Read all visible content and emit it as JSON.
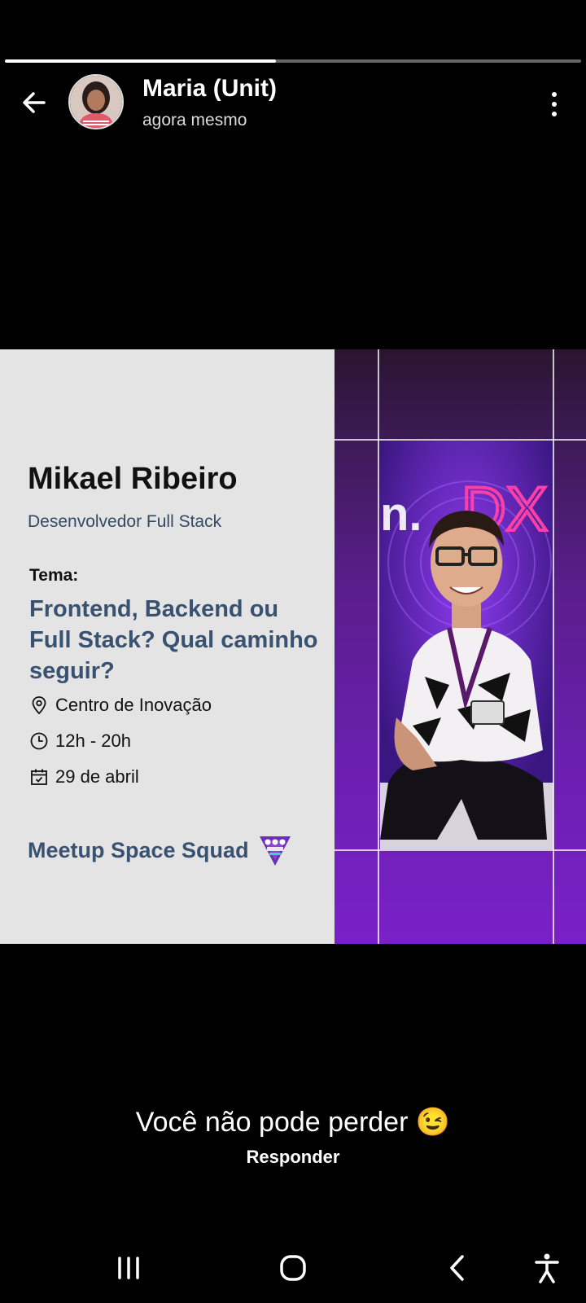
{
  "story": {
    "progress_fraction": 0.47,
    "user_name": "Maria (Unit)",
    "timestamp": "agora mesmo",
    "caption": "Você não pode perder 😉",
    "reply_label": "Responder"
  },
  "card": {
    "speaker_name": "Mikael Ribeiro",
    "speaker_role": "Desenvolvedor Full Stack",
    "tema_label": "Tema:",
    "tema_text": "Frontend, Backend ou Full Stack? Qual caminho seguir?",
    "location": "Centro de Inovação",
    "time": "12h - 20h",
    "date": "29 de abril",
    "meetup_name": "Meetup Space Squad",
    "backdrop_text": "DX"
  },
  "icons": {
    "back": "arrow-left-icon",
    "more": "more-vertical-icon",
    "location": "location-pin-icon",
    "clock": "clock-icon",
    "calendar": "calendar-icon",
    "recents": "recents-icon",
    "home": "home-icon",
    "nav_back": "nav-back-icon",
    "accessibility": "accessibility-icon"
  },
  "colors": {
    "accent_blue": "#3a5272",
    "purple": "#6b1fb0"
  }
}
